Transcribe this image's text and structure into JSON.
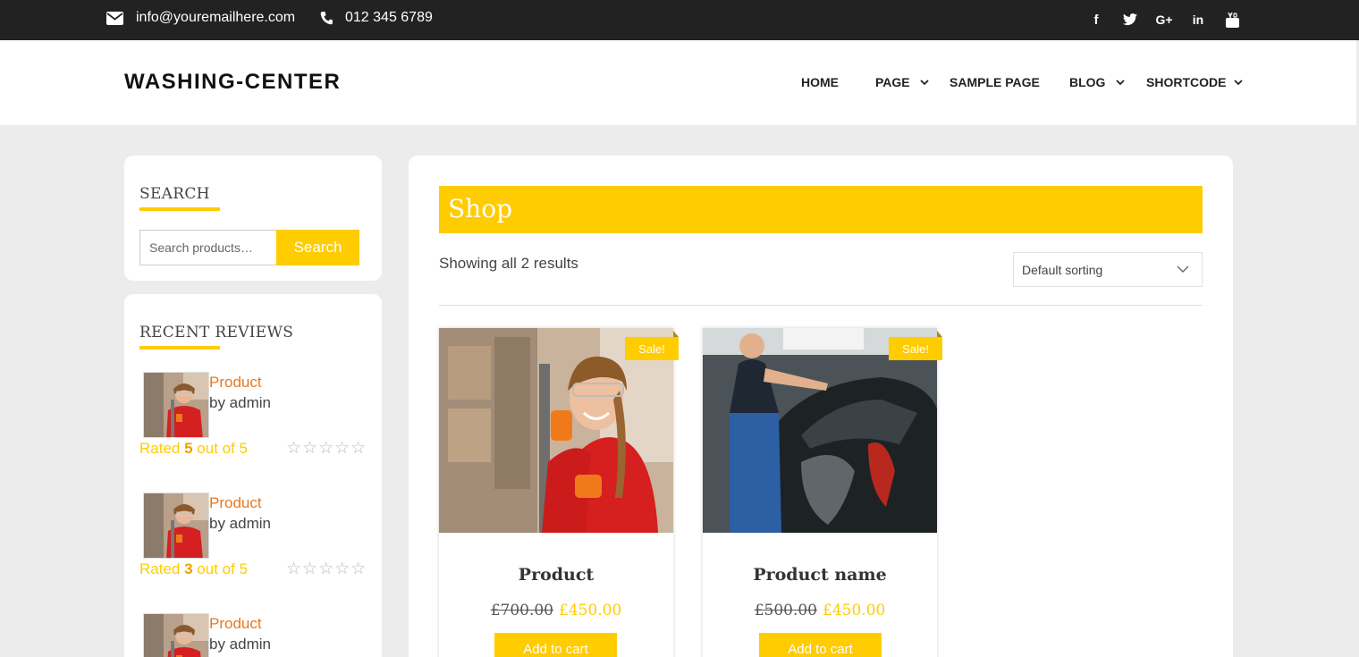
{
  "topbar": {
    "email": "info@youremailhere.com",
    "phone": "012 345 6789",
    "social": [
      {
        "icon": "facebook-icon",
        "glyph": "f"
      },
      {
        "icon": "twitter-icon",
        "glyph": "t"
      },
      {
        "icon": "google-plus-icon",
        "glyph": "G+"
      },
      {
        "icon": "linkedin-icon",
        "glyph": "in"
      },
      {
        "icon": "youtube-icon",
        "glyph": "You"
      }
    ]
  },
  "header": {
    "logo": "WASHING-CENTER",
    "nav": [
      {
        "label": "HOME",
        "has_dropdown": false
      },
      {
        "label": "PAGE",
        "has_dropdown": true
      },
      {
        "label": "SAMPLE PAGE",
        "has_dropdown": false
      },
      {
        "label": "BLOG",
        "has_dropdown": true
      },
      {
        "label": "SHORTCODE",
        "has_dropdown": true
      }
    ]
  },
  "sidebar": {
    "search": {
      "title": "SEARCH",
      "placeholder": "Search products…",
      "button": "Search"
    },
    "reviews": {
      "title": "RECENT REVIEWS",
      "items": [
        {
          "product": "Product",
          "by": "by admin",
          "rated_prefix": "Rated ",
          "rating": "5",
          "rated_suffix": " out of 5",
          "stars": "☆☆☆☆☆"
        },
        {
          "product": "Product",
          "by": "by admin",
          "rated_prefix": "Rated ",
          "rating": "3",
          "rated_suffix": " out of 5",
          "stars": "☆☆☆☆☆"
        },
        {
          "product": "Product",
          "by": "by admin"
        }
      ]
    }
  },
  "shop": {
    "title": "Shop",
    "result_count": "Showing all 2 results",
    "sort": "Default sorting",
    "products": [
      {
        "name": "Product",
        "old_price": "£700.00",
        "price": "£450.00",
        "sale": "Sale!",
        "cart": "Add to cart"
      },
      {
        "name": "Product name",
        "old_price": "£500.00",
        "price": "£450.00",
        "sale": "Sale!",
        "cart": "Add to cart"
      }
    ]
  },
  "colors": {
    "accent": "#ffcc00",
    "topbar": "#222222",
    "link": "#e8771e"
  }
}
